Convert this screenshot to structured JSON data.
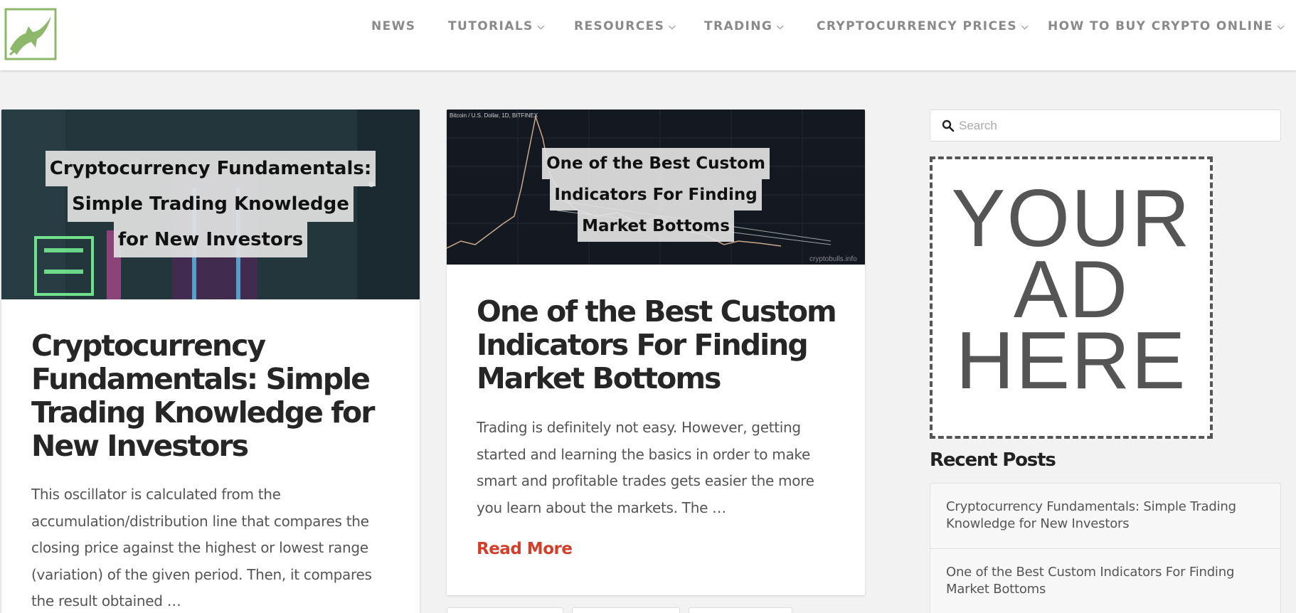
{
  "nav": {
    "items": [
      {
        "label": "NEWS",
        "dropdown": false
      },
      {
        "label": "TUTORIALS",
        "dropdown": true
      },
      {
        "label": "RESOURCES",
        "dropdown": true
      },
      {
        "label": "TRADING",
        "dropdown": true
      },
      {
        "label": "CRYPTOCURRENCY PRICES",
        "dropdown": true
      },
      {
        "label": "HOW TO BUY CRYPTO ONLINE",
        "dropdown": true
      }
    ],
    "dropdown_glyph": "⌵"
  },
  "colors": {
    "logo_green": "#8db86a",
    "accent_red": "#d33f2a",
    "nav_text": "#8a8a8a",
    "background": "#f2f2f2"
  },
  "posts": [
    {
      "thumb_title_lines": [
        "Cryptocurrency Fundamentals:",
        "Simple Trading Knowledge",
        "for New Investors"
      ],
      "title": "Cryptocurrency Fundamentals: Simple Trading Knowledge for New Investors",
      "excerpt": "This oscillator is calculated from the accumulation/distribution line that compares the closing price against the highest or lowest range (variation) of the given period. Then, it compares the result obtained …"
    },
    {
      "thumb_title_lines": [
        "One of the Best Custom",
        "Indicators For Finding",
        "Market Bottoms"
      ],
      "thumb_chart_caption": "Bitcoin / U.S. Dollar, 1D, BITFINEX",
      "thumb_watermark": "cryptobulls.info",
      "title": "One of the Best Custom Indicators For Finding Market Bottoms",
      "excerpt": "Trading is definitely not easy. However, getting started and learning the basics in order to make smart and profitable trades gets easier the more you learn about the markets. The …",
      "read_more": "Read More"
    }
  ],
  "sidebar": {
    "search_placeholder": "Search",
    "ad_lines": [
      "YOUR",
      "AD",
      "HERE"
    ],
    "recent_posts_heading": "Recent Posts",
    "recent_posts": [
      "Cryptocurrency Fundamentals: Simple Trading Knowledge for New Investors",
      "One of the Best Custom Indicators For Finding Market Bottoms"
    ]
  }
}
